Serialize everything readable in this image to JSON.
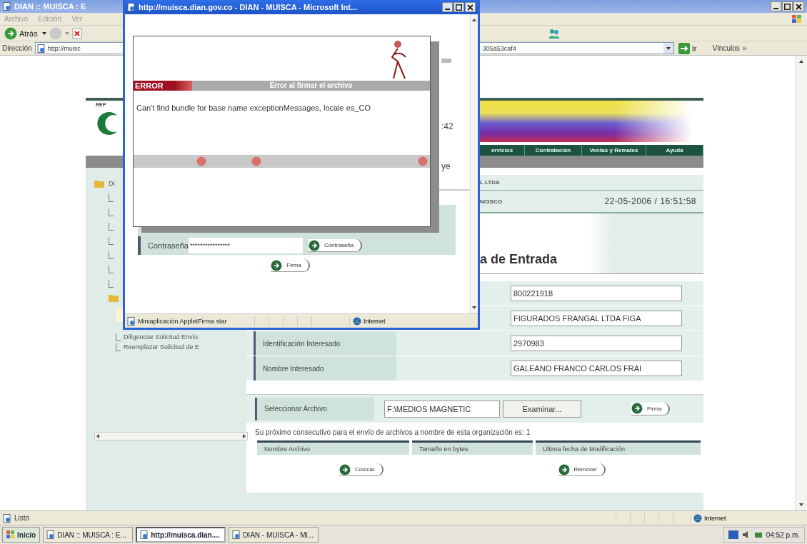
{
  "main_window": {
    "title": "DIAN :: MUISCA : E",
    "menu": [
      "Archivo",
      "Edición",
      "Ver"
    ],
    "back_label": "Atrás",
    "address": {
      "label": "Dirección",
      "value_start": "http://muisc",
      "value_end": "305a53caf4",
      "go_label": "Ir",
      "links_label": "Vínculos",
      "links_more": "»"
    }
  },
  "page": {
    "logo_text": "REP",
    "tree": {
      "root_label": "DI",
      "items": [
        {
          "label": "Diligenciar Solicitud Envío"
        },
        {
          "label": "Reemplazar Solicitud de E"
        }
      ]
    },
    "nav": [
      "ervicios",
      "Contratación",
      "Ventas y Remates",
      "Ayuda"
    ],
    "info": {
      "company": "L LTDA",
      "person": "NCISCO",
      "datetime": "22-05-2006 / 16:51:58"
    },
    "heading": "a de Entrada",
    "fields": [
      {
        "value": "800221918"
      },
      {
        "value": "FIGURADOS FRANGAL LTDA FIGA"
      },
      {
        "label": "Identificación Interesado",
        "value": "2970983"
      },
      {
        "label": "Nombre Interesado",
        "value": "GALEANO FRANCO CARLOS FRAI"
      }
    ],
    "file": {
      "label": "Seleccionar Archivo",
      "value": "F:\\MEDIOS MAGNETIC",
      "browse": "Examinar...",
      "sign": "Firma"
    },
    "note": "Su próximo consecutivo para el envío de archivos a nombre de esta organización es: 1",
    "table": {
      "columns": [
        "Nombre Archivo",
        "Tamaño en bytes",
        "Última fecha de Modificación"
      ]
    },
    "actions": [
      "Colocar",
      "Remover"
    ]
  },
  "status_bar": {
    "text": "Listo",
    "zone": "Internet"
  },
  "popup": {
    "title": "http://muisca.dian.gov.co - DIAN - MUISCA - Microsoft Int...",
    "fragments": [
      ":42",
      "ye"
    ],
    "dialog": {
      "error_label": "ERROR",
      "error_title": "Error al firmar el archivo",
      "message": "Can't find bundle for base name exceptionMessages, locale es_CO"
    },
    "password": {
      "label": "Contraseña",
      "value": "****************",
      "button": "Contraseña"
    },
    "sign_button": "Firma",
    "status": {
      "text": "Miniaplicación AppletFirma star",
      "zone": "Internet"
    }
  },
  "taskbar": {
    "start": "Inicio",
    "tasks": [
      {
        "label": "DIAN :: MUISCA : E...",
        "selected": false
      },
      {
        "label": "http://muisca.dian....",
        "selected": true
      },
      {
        "label": "DIAN - MUISCA - Mi...",
        "selected": false
      }
    ],
    "clock": "04:52 p.m."
  }
}
